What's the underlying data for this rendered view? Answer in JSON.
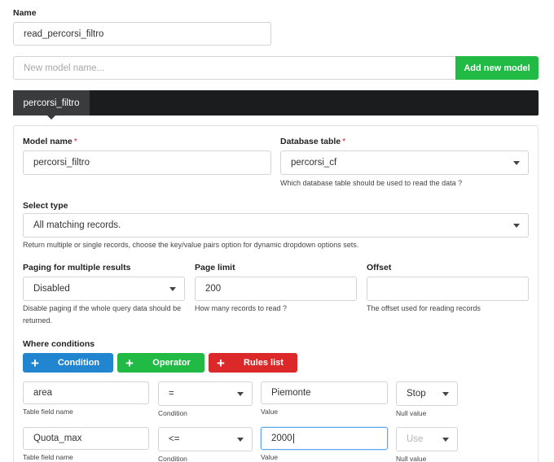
{
  "top": {
    "name_label": "Name",
    "name_value": "read_percorsi_filtro",
    "new_model_placeholder": "New model name...",
    "add_model_button": "Add new model"
  },
  "tabs": [
    {
      "label": "percorsi_filtro",
      "active": true
    }
  ],
  "model": {
    "model_name_label": "Model name",
    "model_name_value": "percorsi_filtro",
    "db_table_label": "Database table",
    "db_table_value": "percorsi_cf",
    "db_table_help": "Which database table should be used to read the data ?",
    "select_type_label": "Select type",
    "select_type_value": "All matching records.",
    "select_type_help": "Return multiple or single records, choose the key/value pairs option for dynamic dropdown options sets.",
    "paging_label": "Paging for multiple results",
    "paging_value": "Disabled",
    "paging_help": "Disable paging if the whole query data should be returned.",
    "page_limit_label": "Page limit",
    "page_limit_value": "200",
    "page_limit_help": "How many records to read ?",
    "offset_label": "Offset",
    "offset_value": "",
    "offset_help": "The offset used for reading records"
  },
  "where": {
    "label": "Where conditions",
    "buttons": {
      "condition": "Condition",
      "operator": "Operator",
      "rules_list": "Rules list"
    },
    "rows": [
      {
        "field": "area",
        "condition": "=",
        "value": "Piemonte",
        "null_value": "Stop",
        "field_caption": "Table field name",
        "condition_caption": "Condition",
        "value_caption": "Value",
        "null_caption": "Null value"
      },
      {
        "field": "Quota_max",
        "condition": "<=",
        "value": "2000",
        "null_value": "Use",
        "field_caption": "Table field name",
        "condition_caption": "Condition",
        "value_caption": "Value",
        "null_caption": "Null value"
      }
    ]
  },
  "colors": {
    "accent_green": "#21ba45",
    "accent_blue": "#2185d0",
    "accent_red": "#db2828",
    "tabbar_dark": "#1b1c1d",
    "required_red": "#d9232e"
  }
}
